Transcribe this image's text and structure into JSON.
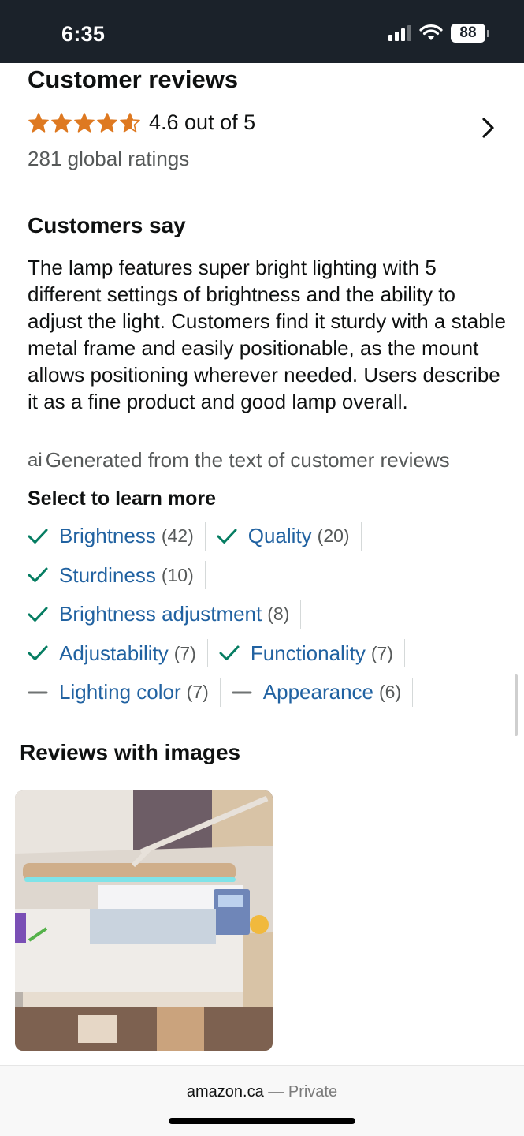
{
  "status_bar": {
    "time": "6:35",
    "battery": "88"
  },
  "reviews": {
    "title": "Customer reviews",
    "rating_text": "4.6 out of 5",
    "rating_value": 4.6,
    "global_ratings": "281 global ratings"
  },
  "customers_say": {
    "title": "Customers say",
    "summary": "The lamp features super bright lighting with 5 different settings of brightness and the ability to adjust the light. Customers find it sturdy with a stable metal frame and easily positionable, as the mount allows positioning wherever needed. Users describe it as a fine product and good lamp overall.",
    "ai_note": "Generated from the text of customer reviews",
    "ai_icon": "ai"
  },
  "select_to_learn": {
    "title": "Select to learn more",
    "rows": [
      [
        {
          "name": "Brightness",
          "count": "(42)",
          "sentiment": "positive"
        },
        {
          "name": "Quality",
          "count": "(20)",
          "sentiment": "positive"
        }
      ],
      [
        {
          "name": "Sturdiness",
          "count": "(10)",
          "sentiment": "positive"
        }
      ],
      [
        {
          "name": "Brightness adjustment",
          "count": "(8)",
          "sentiment": "positive"
        }
      ],
      [
        {
          "name": "Adjustability",
          "count": "(7)",
          "sentiment": "positive"
        },
        {
          "name": "Functionality",
          "count": "(7)",
          "sentiment": "positive"
        }
      ],
      [
        {
          "name": "Lighting color",
          "count": "(7)",
          "sentiment": "mixed"
        },
        {
          "name": "Appearance",
          "count": "(6)",
          "sentiment": "mixed"
        }
      ]
    ]
  },
  "reviews_with_images": {
    "title": "Reviews with images"
  },
  "browser": {
    "domain": "amazon.ca",
    "separator": "—",
    "mode": "Private"
  },
  "colors": {
    "star": "#de7921",
    "link": "#2162a1",
    "check": "#067d62",
    "status_bar": "#1b222a"
  }
}
